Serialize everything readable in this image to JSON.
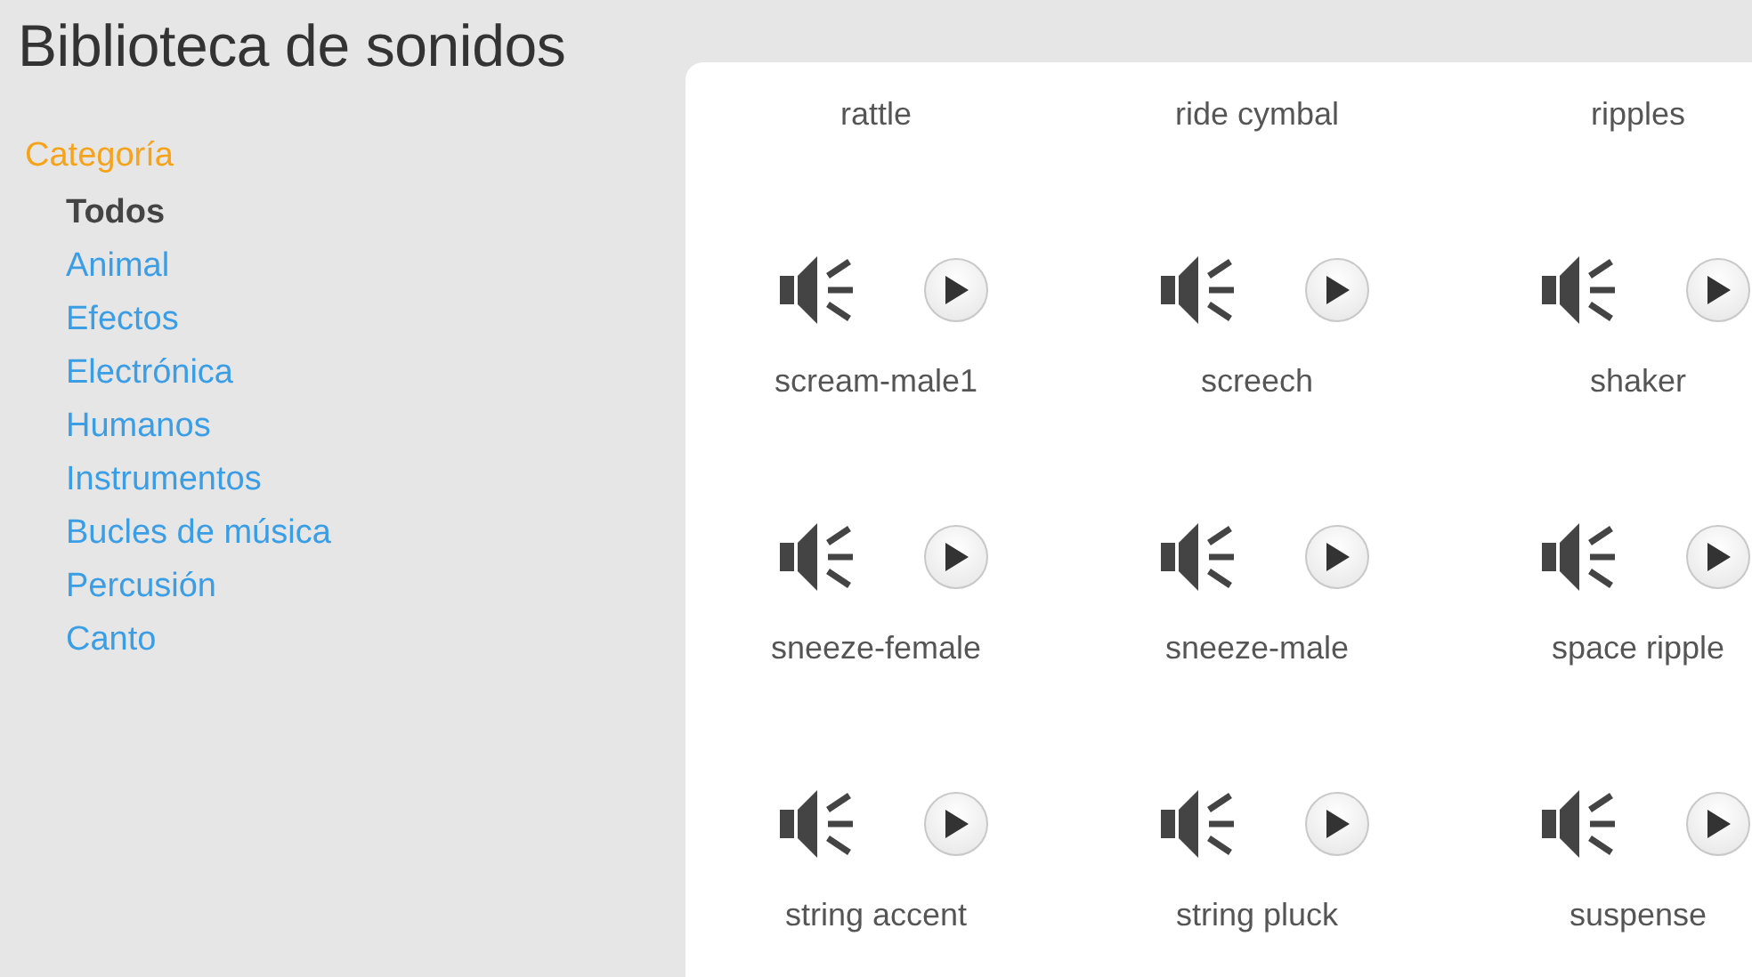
{
  "title": "Biblioteca de sonidos",
  "sidebar": {
    "heading": "Categoría",
    "items": [
      {
        "label": "Todos",
        "selected": true
      },
      {
        "label": "Animal",
        "selected": false
      },
      {
        "label": "Efectos",
        "selected": false
      },
      {
        "label": "Electrónica",
        "selected": false
      },
      {
        "label": "Humanos",
        "selected": false
      },
      {
        "label": "Instrumentos",
        "selected": false
      },
      {
        "label": "Bucles de música",
        "selected": false
      },
      {
        "label": "Percusión",
        "selected": false
      },
      {
        "label": "Canto",
        "selected": false
      }
    ]
  },
  "sounds": [
    {
      "name": "rattle",
      "kind": "label-only"
    },
    {
      "name": "ride cymbal",
      "kind": "label-only"
    },
    {
      "name": "ripples",
      "kind": "label-only"
    },
    {
      "name": "scream-male1",
      "kind": "full"
    },
    {
      "name": "screech",
      "kind": "full"
    },
    {
      "name": "shaker",
      "kind": "full"
    },
    {
      "name": "sneeze-female",
      "kind": "full"
    },
    {
      "name": "sneeze-male",
      "kind": "full"
    },
    {
      "name": "space ripple",
      "kind": "full"
    },
    {
      "name": "string accent",
      "kind": "full"
    },
    {
      "name": "string pluck",
      "kind": "full"
    },
    {
      "name": "suspense",
      "kind": "full"
    }
  ]
}
